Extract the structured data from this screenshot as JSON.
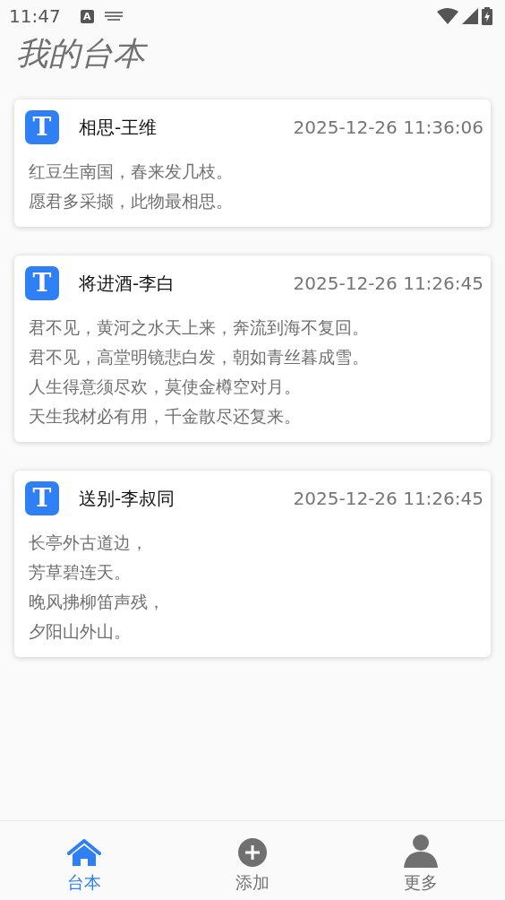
{
  "status_bar": {
    "time": "11:47",
    "badge_letter": "A"
  },
  "header": {
    "title": "我的台本"
  },
  "scripts": [
    {
      "badge": "T",
      "title": "相思-王维",
      "time": "2025-12-26 11:36:06",
      "lines": [
        "红豆生南国，春来发几枝。",
        "愿君多采撷，此物最相思。"
      ]
    },
    {
      "badge": "T",
      "title": "将进酒-李白",
      "time": "2025-12-26 11:26:45",
      "lines": [
        "君不见，黄河之水天上来，奔流到海不复回。",
        "君不见，高堂明镜悲白发，朝如青丝暮成雪。",
        "人生得意须尽欢，莫使金樽空对月。",
        "天生我材必有用，千金散尽还复来。"
      ]
    },
    {
      "badge": "T",
      "title": "送别-李叔同",
      "time": "2025-12-26 11:26:45",
      "lines": [
        "长亭外古道边，",
        "芳草碧连天。",
        "晚风拂柳笛声残，",
        "夕阳山外山。"
      ]
    }
  ],
  "bottom_nav": [
    {
      "kind": "home",
      "label": "台本",
      "selected": true
    },
    {
      "kind": "add",
      "label": "添加",
      "selected": false
    },
    {
      "kind": "person",
      "label": "更多",
      "selected": false
    }
  ]
}
